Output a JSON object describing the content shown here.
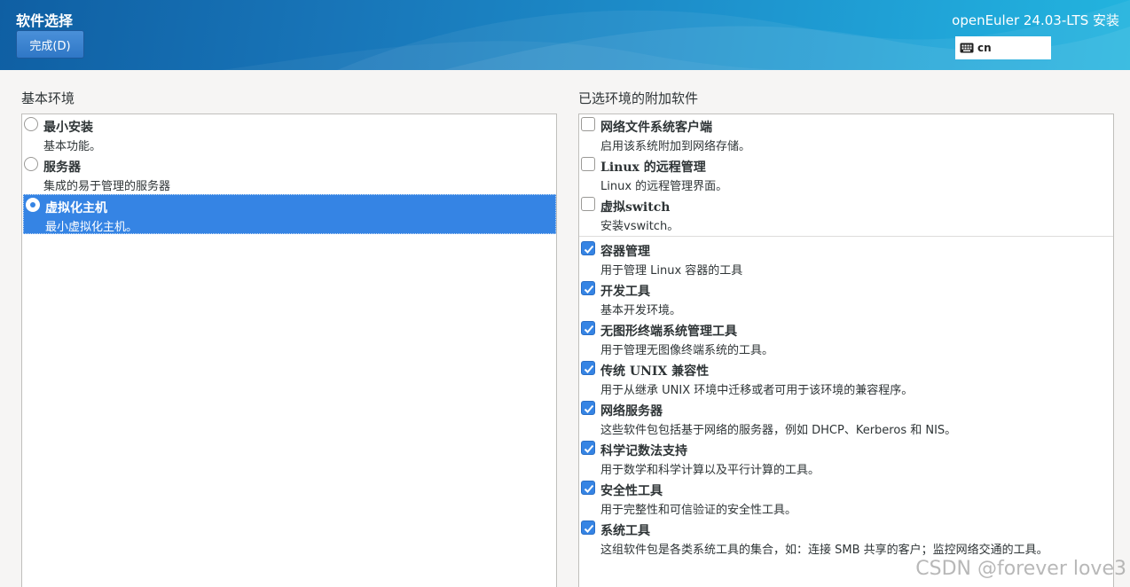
{
  "header": {
    "title": "软件选择",
    "done_label": "完成(D)",
    "product_title": "openEuler 24.03-LTS 安装",
    "keyboard_layout": "cn",
    "keyboard_icon": "keyboard-icon"
  },
  "base_env": {
    "label": "基本环境",
    "items": [
      {
        "name": "最小安装",
        "desc": "基本功能。",
        "selected": false
      },
      {
        "name": "服务器",
        "desc": "集成的易于管理的服务器",
        "selected": false
      },
      {
        "name": "虚拟化主机",
        "desc": "最小虚拟化主机。",
        "selected": true
      }
    ]
  },
  "addons": {
    "label": "已选环境的附加软件",
    "items": [
      {
        "name": "网络文件系统客户端",
        "desc": "启用该系统附加到网络存储。",
        "checked": false
      },
      {
        "name": "Linux 的远程管理",
        "desc": "Linux 的远程管理界面。",
        "checked": false
      },
      {
        "name": "虚拟switch",
        "desc": "安装vswitch。",
        "checked": false
      },
      {
        "name": "容器管理",
        "desc": "用于管理 Linux 容器的工具",
        "checked": true
      },
      {
        "name": "开发工具",
        "desc": "基本开发环境。",
        "checked": true
      },
      {
        "name": "无图形终端系统管理工具",
        "desc": "用于管理无图像终端系统的工具。",
        "checked": true
      },
      {
        "name": "传统 UNIX 兼容性",
        "desc": "用于从继承 UNIX 环境中迁移或者可用于该环境的兼容程序。",
        "checked": true
      },
      {
        "name": "网络服务器",
        "desc": "这些软件包包括基于网络的服务器，例如 DHCP、Kerberos 和 NIS。",
        "checked": true
      },
      {
        "name": "科学记数法支持",
        "desc": "用于数学和科学计算以及平行计算的工具。",
        "checked": true
      },
      {
        "name": "安全性工具",
        "desc": "用于完整性和可信验证的安全性工具。",
        "checked": true
      },
      {
        "name": "系统工具",
        "desc": "这组软件包是各类系统工具的集合，如：连接 SMB 共享的客户；监控网络交通的工具。",
        "checked": true
      }
    ]
  },
  "watermark": "CSDN @forever love3",
  "colors": {
    "accent": "#3584e4",
    "header_start": "#0f5fa3",
    "header_end": "#23b4de"
  }
}
